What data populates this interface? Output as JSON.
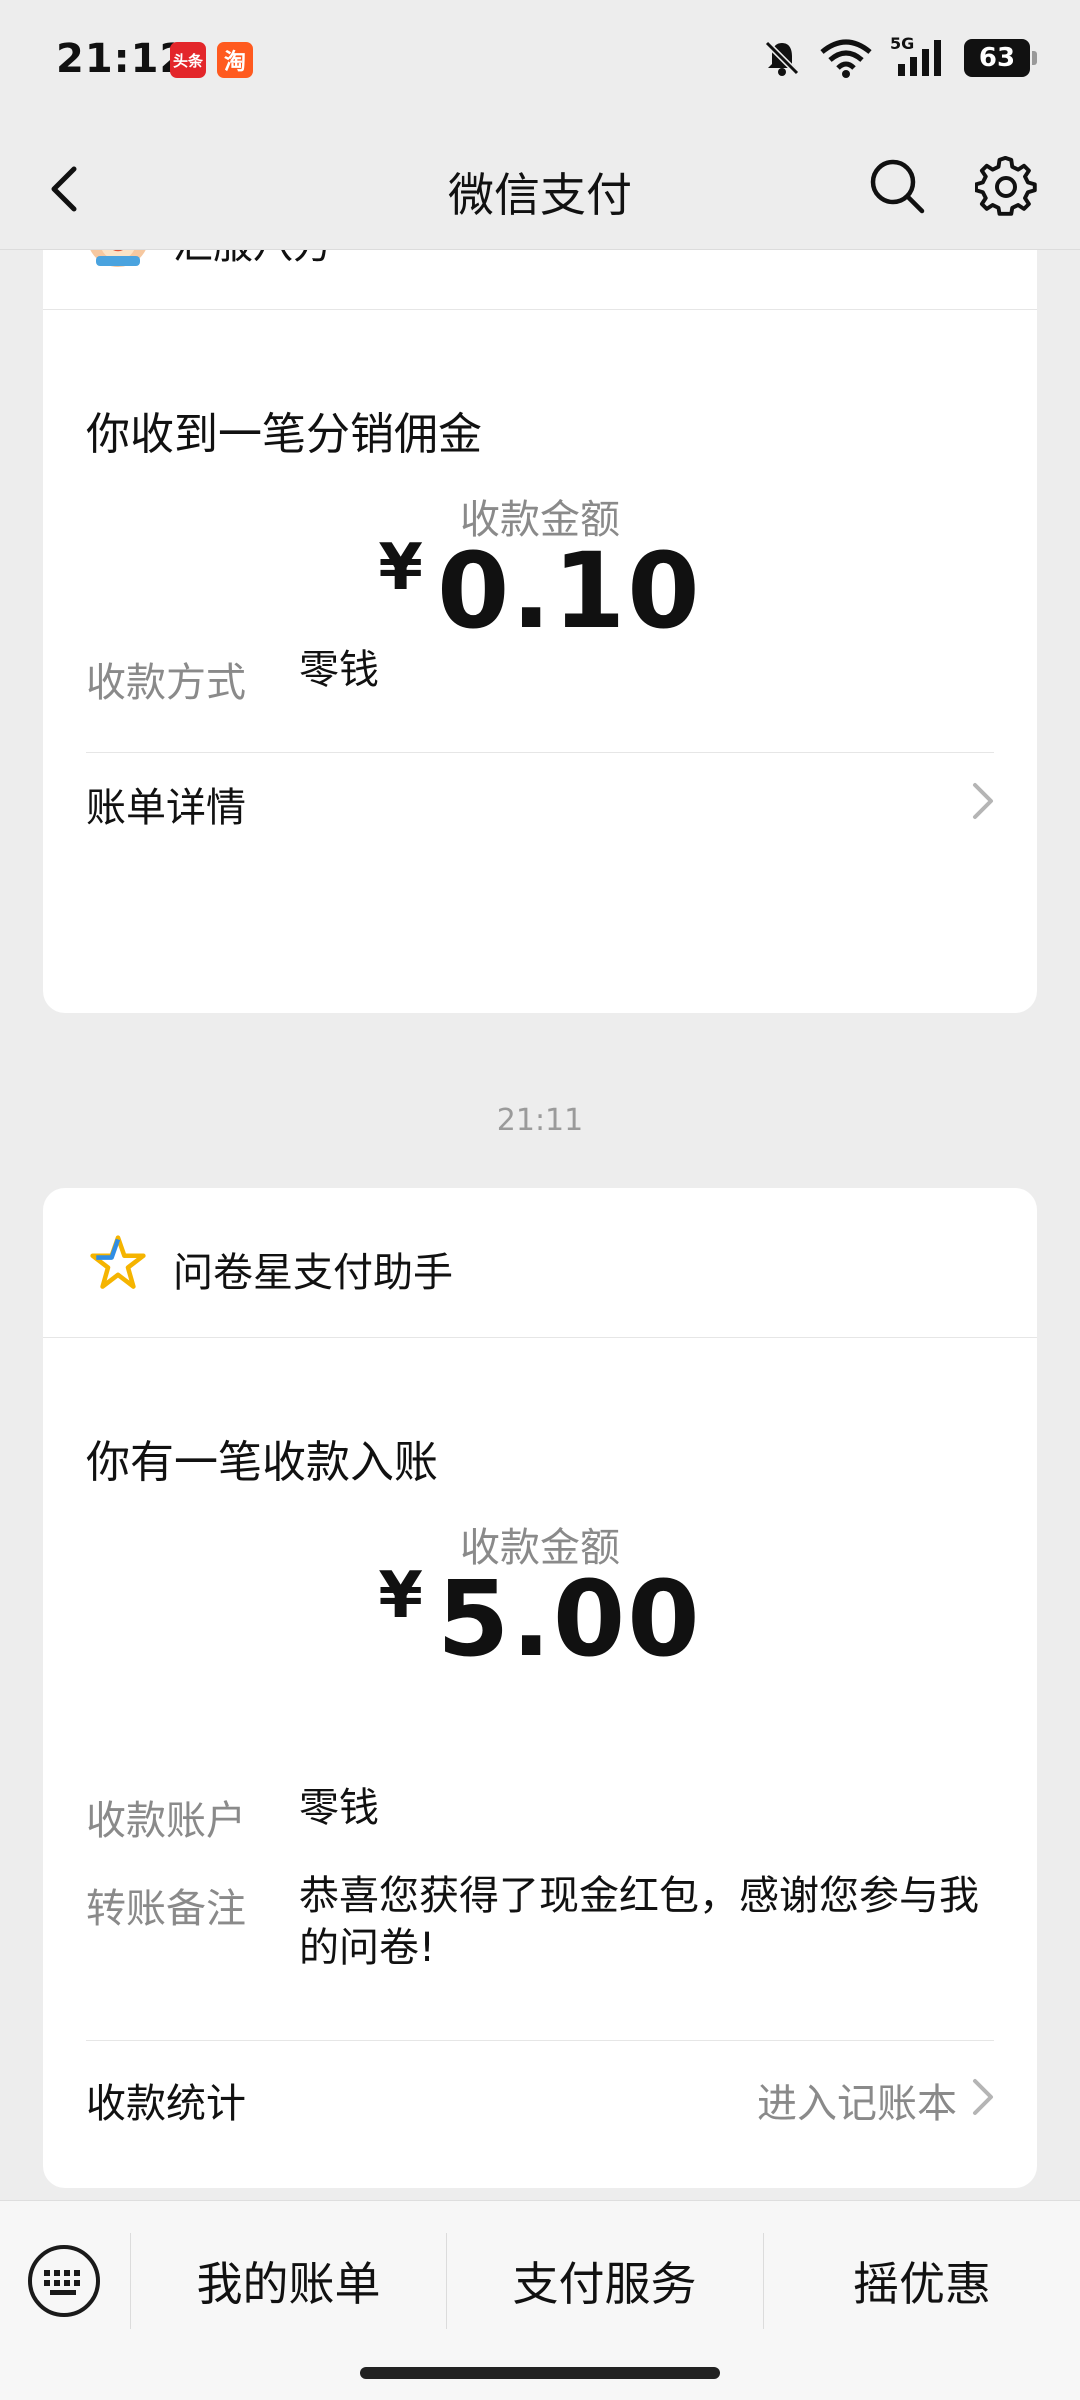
{
  "status_bar": {
    "time": "21:12",
    "app_badge_1": "头条",
    "app_badge_2": "淘",
    "network": "5G",
    "battery": "63"
  },
  "nav": {
    "title": "微信支付"
  },
  "card1": {
    "sender": "汇服八方",
    "title": "你收到一笔分销佣金",
    "amount_label": "收款金额",
    "currency": "¥",
    "amount": "0.10",
    "method_label": "收款方式",
    "method_value": "零钱",
    "footer_label": "账单详情"
  },
  "timestamp": "21:11",
  "card2": {
    "sender": "问卷星支付助手",
    "title": "你有一笔收款入账",
    "amount_label": "收款金额",
    "currency": "¥",
    "amount": "5.00",
    "account_label": "收款账户",
    "account_value": "零钱",
    "note_label": "转账备注",
    "note_value": "恭喜您获得了现金红包，感谢您参与我的问卷!",
    "footer_label": "收款统计",
    "footer_link": "进入记账本"
  },
  "bottom_menu": {
    "items": [
      "我的账单",
      "支付服务",
      "摇优惠"
    ]
  },
  "colors": {
    "background": "#ededed",
    "card": "#ffffff",
    "secondary_text": "#8a8a8a",
    "star_gold": "#f5b400",
    "star_blue": "#2f8de4"
  }
}
